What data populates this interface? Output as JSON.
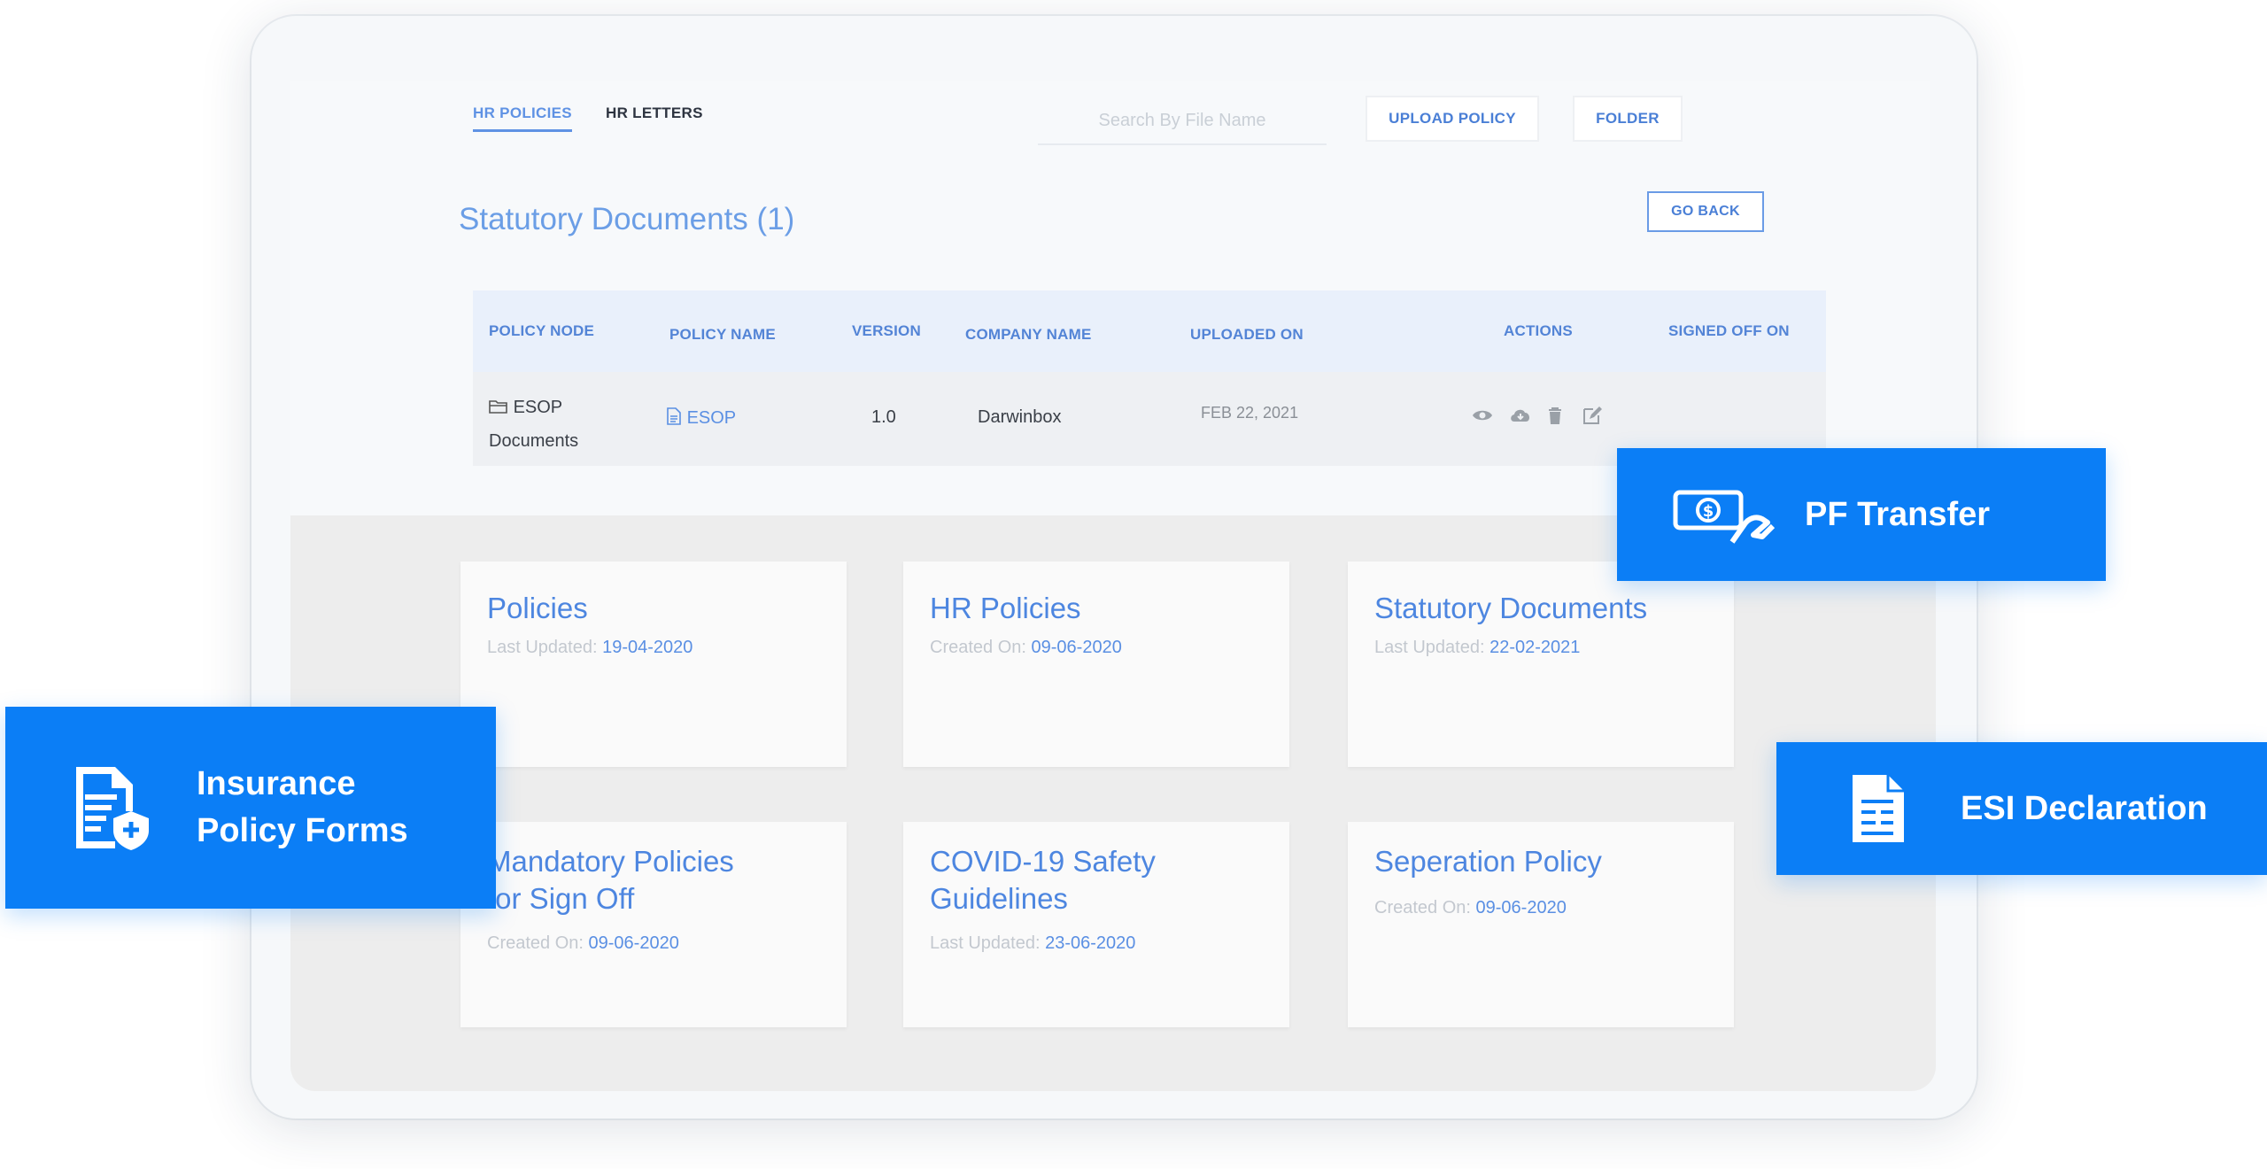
{
  "tabs": [
    {
      "label": "HR POLICIES",
      "active": true
    },
    {
      "label": "HR LETTERS",
      "active": false
    }
  ],
  "search": {
    "placeholder": "Search By File Name"
  },
  "toolbar": {
    "upload_label": "UPLOAD POLICY",
    "folder_label": "FOLDER",
    "go_back_label": "GO BACK"
  },
  "page_title": "Statutory Documents (1)",
  "table": {
    "columns": [
      "POLICY NODE",
      "POLICY NAME",
      "VERSION",
      "COMPANY NAME",
      "UPLOADED ON",
      "ACTIONS",
      "SIGNED OFF ON"
    ],
    "rows": [
      {
        "node_line1": "ESOP",
        "node_line2": "Documents",
        "policy_name": "ESOP",
        "version": "1.0",
        "company": "Darwinbox",
        "uploaded_on": "FEB 22, 2021",
        "actions": [
          "eye-icon",
          "cloud-download-icon",
          "trash-icon",
          "edit-icon"
        ],
        "signed_off_on": ""
      }
    ]
  },
  "cards": [
    {
      "title": "Policies",
      "meta_label": "Last Updated:",
      "meta_value": "19-04-2020"
    },
    {
      "title": "HR Policies",
      "meta_label": "Created On:",
      "meta_value": "09-06-2020"
    },
    {
      "title": "Statutory Documents",
      "meta_label": "Last Updated:",
      "meta_value": "22-02-2021"
    },
    {
      "title_line1": "Mandatory Policies",
      "title_line2": "for Sign Off",
      "meta_label": "Created On:",
      "meta_value": "09-06-2020"
    },
    {
      "title_line1": "COVID-19 Safety",
      "title_line2": "Guidelines",
      "meta_label": "Last Updated:",
      "meta_value": "23-06-2020"
    },
    {
      "title": "Seperation Policy",
      "meta_label": "Created On:",
      "meta_value": "09-06-2020"
    }
  ],
  "promos": {
    "pf_transfer": "PF Transfer",
    "insurance_line1": "Insurance",
    "insurance_line2": "Policy Forms",
    "esi": "ESI Declaration"
  },
  "colors": {
    "brand_blue": "#0b7ef6",
    "accent": "#5f92e4"
  }
}
